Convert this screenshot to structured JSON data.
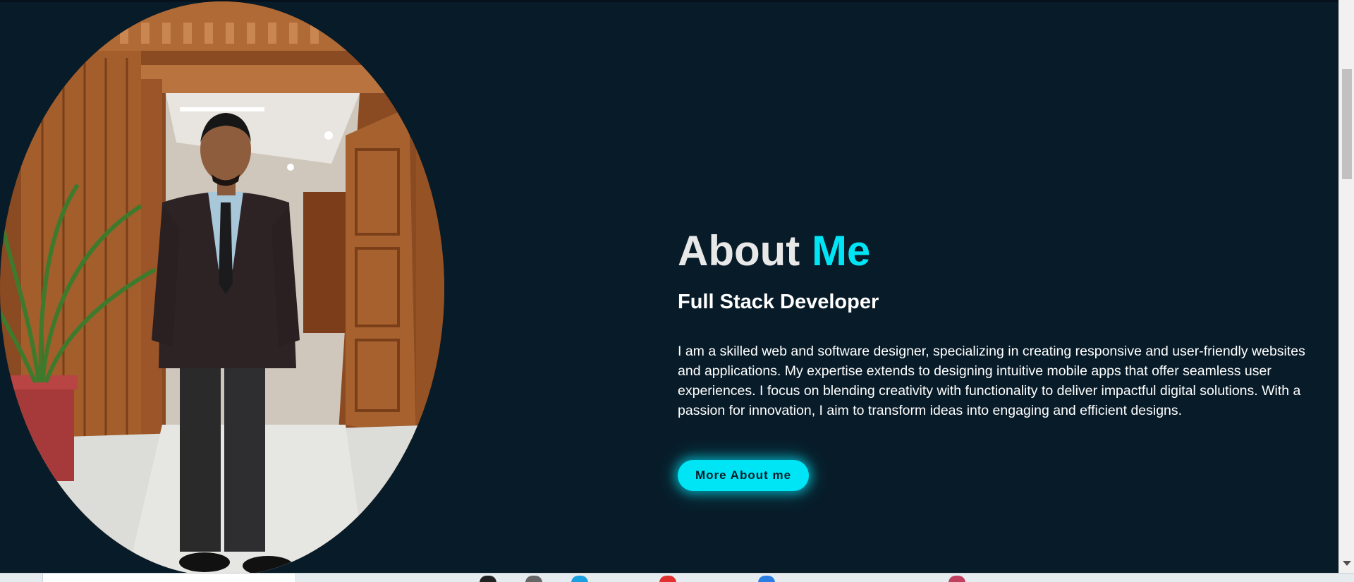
{
  "about": {
    "title_main": "About ",
    "title_accent": "Me",
    "subtitle": "Full Stack Developer",
    "description": "I am a skilled web and software designer, specializing in creating responsive and user-friendly websites and applications. My expertise extends to designing intuitive mobile apps that offer seamless user experiences. I focus on blending creativity with functionality to deliver impactful digital solutions. With a passion for innovation, I aim to transform ideas into engaging and efficient designs.",
    "button_label": "More About me"
  },
  "colors": {
    "background": "#081b28",
    "accent": "#00e5f5",
    "text": "#ffffff"
  },
  "icons": {
    "scroll_down": "chevron-down-icon"
  }
}
